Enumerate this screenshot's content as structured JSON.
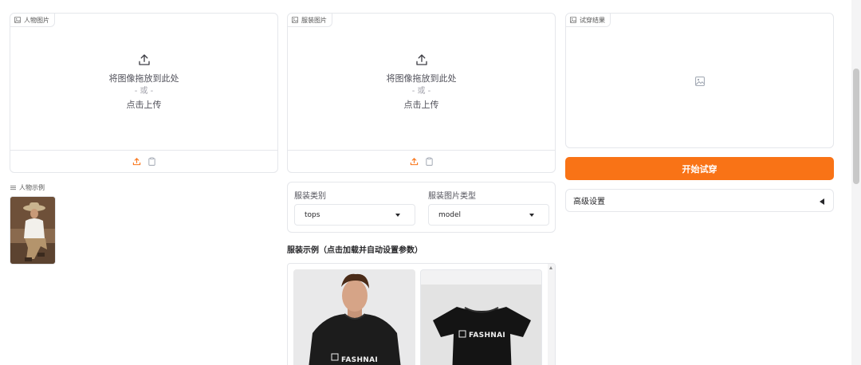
{
  "person_panel": {
    "label": "人物图片",
    "drop_text": "将图像拖放到此处",
    "or_text": "- 或 -",
    "click_text": "点击上传"
  },
  "garment_panel": {
    "label": "服装图片",
    "drop_text": "将图像拖放到此处",
    "or_text": "- 或 -",
    "click_text": "点击上传"
  },
  "result_panel": {
    "label": "试穿结果"
  },
  "person_examples": {
    "label": "人物示例"
  },
  "settings": {
    "category_label": "服装类别",
    "category_value": "tops",
    "photo_type_label": "服装图片类型",
    "photo_type_value": "model"
  },
  "garment_examples": {
    "title": "服装示例（点击加载并自动设置参数）",
    "items": [
      {
        "brand": "FASHNAI"
      },
      {
        "brand": "FASHNAI"
      }
    ]
  },
  "actions": {
    "run_label": "开始试穿",
    "advanced_label": "高级设置"
  },
  "colors": {
    "accent": "#f97316",
    "border": "#e5e7eb"
  }
}
